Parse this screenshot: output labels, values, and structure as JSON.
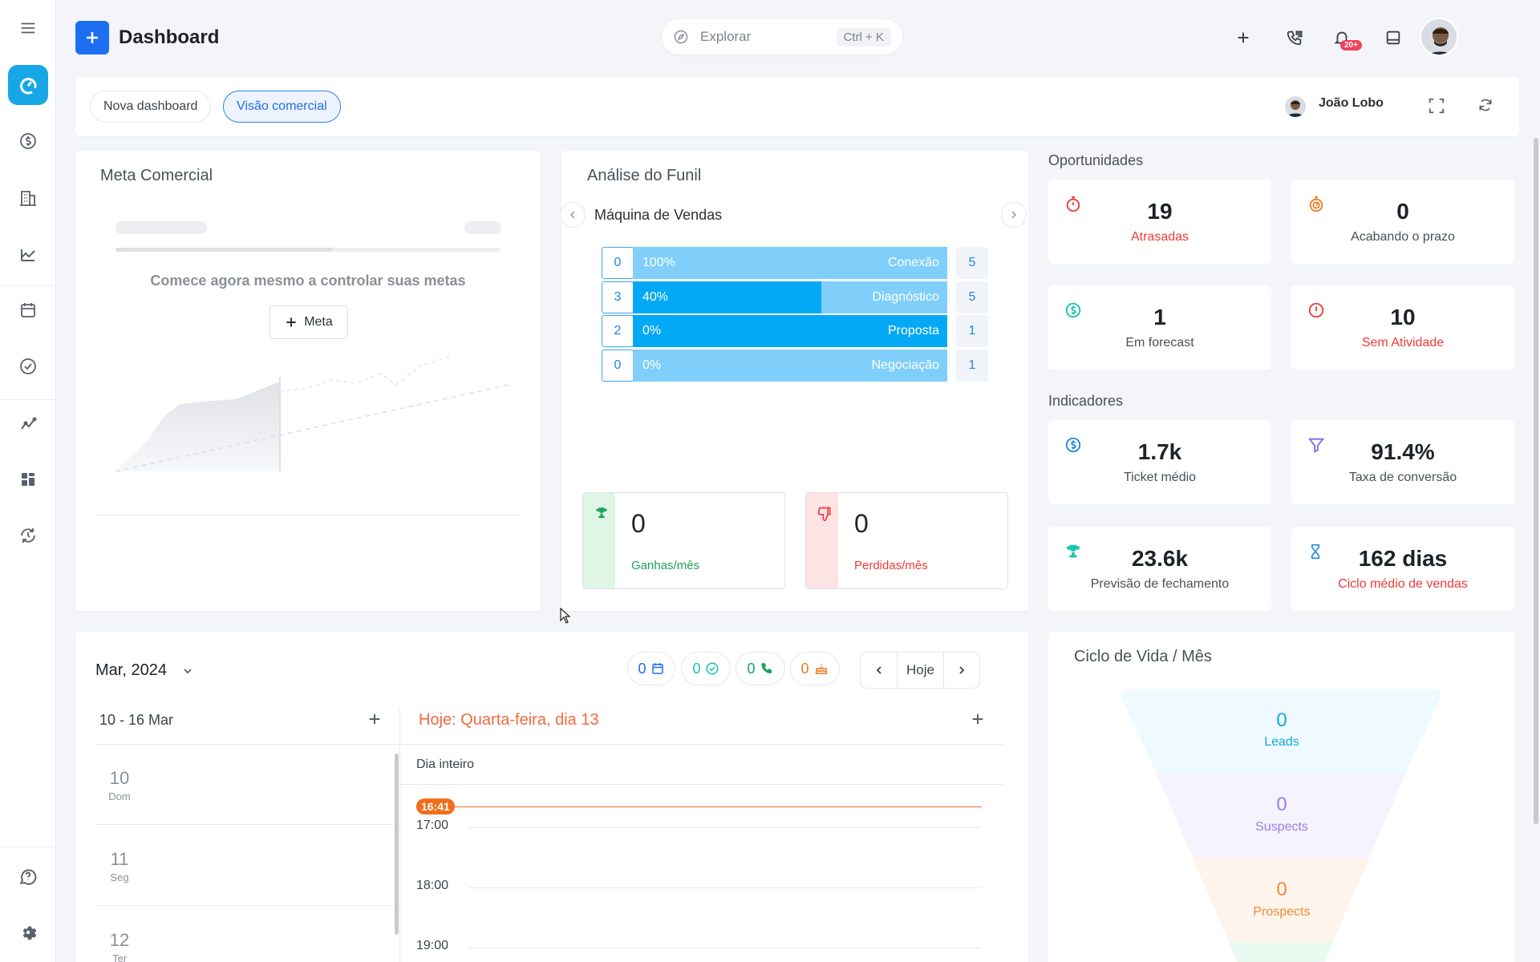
{
  "header": {
    "title": "Dashboard",
    "search_placeholder": "Explorar",
    "search_shortcut": "Ctrl + K",
    "notification_badge": "20+"
  },
  "tabs": [
    {
      "label": "Nova dashboard",
      "active": false
    },
    {
      "label": "Visão comercial",
      "active": true
    }
  ],
  "user": {
    "name": "João Lobo"
  },
  "meta_comercial": {
    "title": "Meta Comercial",
    "empty_text": "Comece agora mesmo a controlar suas metas",
    "button": "Meta"
  },
  "funil": {
    "title": "Análise do Funil",
    "pipeline": "Máquina de Vendas",
    "stages": [
      {
        "count": "0",
        "pct": "100%",
        "fill": 0,
        "name": "Conexão",
        "total": "5"
      },
      {
        "count": "3",
        "pct": "40%",
        "fill": 0.6,
        "name": "Diagnóstico",
        "total": "5"
      },
      {
        "count": "2",
        "pct": "0%",
        "fill": 1,
        "name": "Proposta",
        "total": "1"
      },
      {
        "count": "0",
        "pct": "0%",
        "fill": 0,
        "name": "Negociação",
        "total": "1"
      }
    ],
    "won": {
      "value": "0",
      "label": "Ganhas/mês"
    },
    "lost": {
      "value": "0",
      "label": "Perdidas/mês"
    }
  },
  "oportunidades": {
    "title": "Oportunidades",
    "items": [
      {
        "value": "19",
        "label": "Atrasadas",
        "icon": "timer-icon"
      },
      {
        "value": "0",
        "label": "Acabando o prazo",
        "icon": "stopwatch-icon"
      },
      {
        "value": "1",
        "label": "Em forecast",
        "icon": "dollar-icon"
      },
      {
        "value": "10",
        "label": "Sem Atividade",
        "icon": "alert-icon"
      }
    ]
  },
  "indicadores": {
    "title": "Indicadores",
    "items": [
      {
        "value": "1.7k",
        "label": "Ticket médio",
        "icon": "dollar-icon"
      },
      {
        "value": "91.4%",
        "label": "Taxa de conversão",
        "icon": "filter-icon"
      },
      {
        "value": "23.6k",
        "label": "Previsão de fechamento",
        "icon": "trophy-icon"
      },
      {
        "value": "162 dias",
        "label": "Ciclo médio de vendas",
        "icon": "hourglass-icon"
      }
    ]
  },
  "calendar": {
    "month": "Mar, 2024",
    "week": "10 - 16 Mar",
    "today": "Hoje: Quarta-feira, dia 13",
    "today_btn": "Hoje",
    "all_day": "Dia inteiro",
    "now": "16:41",
    "chips": [
      {
        "value": "0",
        "icon": "calendar-icon",
        "color": "#1e6ef4"
      },
      {
        "value": "0",
        "icon": "check-icon",
        "color": "#17c3b2"
      },
      {
        "value": "0",
        "icon": "phone-icon",
        "color": "#19a35b"
      },
      {
        "value": "0",
        "icon": "cake-icon",
        "color": "#f27b21"
      }
    ],
    "days": [
      {
        "num": "10",
        "name": "Dom"
      },
      {
        "num": "11",
        "name": "Seg"
      },
      {
        "num": "12",
        "name": "Ter"
      }
    ],
    "hours": [
      "17:00",
      "18:00",
      "19:00"
    ]
  },
  "ciclo_vida": {
    "title": "Ciclo de Vida / Mês",
    "stages": [
      {
        "value": "0",
        "label": "Leads",
        "color": "#1aa6e0"
      },
      {
        "value": "0",
        "label": "Suspects",
        "color": "#9b7ee8"
      },
      {
        "value": "0",
        "label": "Prospects",
        "color": "#f08a3a"
      }
    ]
  }
}
